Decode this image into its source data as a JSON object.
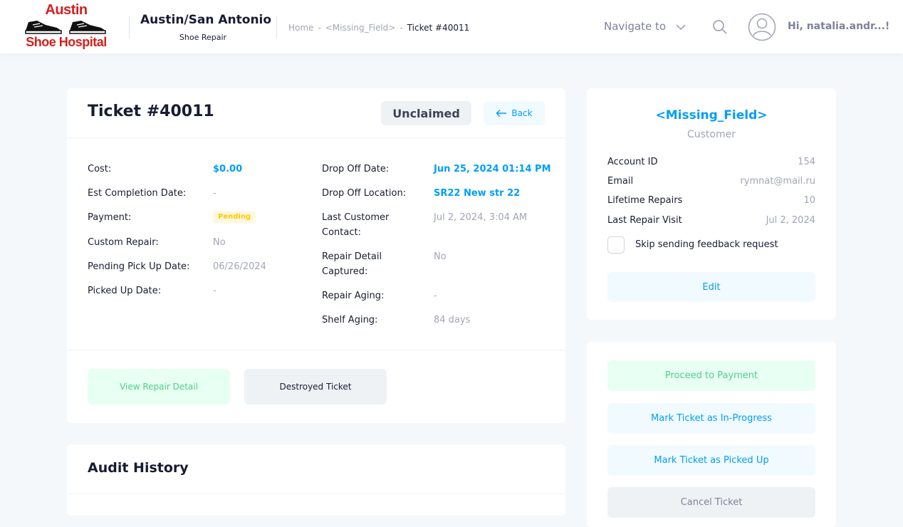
{
  "header": {
    "logo_line1": "Austin",
    "logo_line2": "Shoe Hospital",
    "brand_title": "Austin/San Antonio",
    "brand_subtitle": "Shoe Repair",
    "breadcrumb": [
      "Home",
      "<Missing_Field>",
      "Ticket #40011"
    ],
    "breadcrumb_sep": "-",
    "navigate_label": "Navigate to",
    "greeting": "Hi, natalia.andr...!",
    "icons": [
      "chevron-down-icon",
      "search-icon",
      "user-avatar-icon"
    ]
  },
  "ticket": {
    "title": "Ticket #40011",
    "status": "Unclaimed",
    "back_label": "Back",
    "left_fields": [
      {
        "label": "Cost:",
        "value": "$0.00"
      },
      {
        "label": "Est Completion Date:",
        "value": "-"
      },
      {
        "label": "Payment:",
        "value": "Pending"
      },
      {
        "label": "Custom Repair:",
        "value": "No"
      },
      {
        "label": "Pending Pick Up Date:",
        "value": "06/26/2024"
      },
      {
        "label": "Picked Up Date:",
        "value": "-"
      }
    ],
    "right_fields": [
      {
        "label": "Drop Off Date:",
        "value": "Jun 25, 2024 01:14 PM"
      },
      {
        "label": "Drop Off Location:",
        "value": "SR22 New str 22"
      },
      {
        "label": "Last Customer Contact:",
        "value": "Jul 2, 2024, 3:04 AM"
      },
      {
        "label": "Repair Detail Captured:",
        "value": "No"
      },
      {
        "label": "Repair Aging:",
        "value": "-"
      },
      {
        "label": "Shelf Aging:",
        "value": "84 days"
      }
    ],
    "view_repair_label": "View Repair Detail",
    "destroyed_label": "Destroyed Ticket"
  },
  "audit": {
    "title": "Audit History"
  },
  "customer": {
    "name": "<Missing_Field>",
    "role": "Customer",
    "rows": [
      {
        "label": "Account ID",
        "value": "154"
      },
      {
        "label": "Email",
        "value": "rymnat@mail.ru"
      },
      {
        "label": "Lifetime Repairs",
        "value": "10"
      },
      {
        "label": "Last Repair Visit",
        "value": "Jul 2, 2024"
      }
    ],
    "skip_feedback_label": "Skip sending feedback request",
    "edit_label": "Edit"
  },
  "actions": {
    "proceed_payment": "Proceed to Payment",
    "mark_in_progress": "Mark Ticket as In-Progress",
    "mark_picked_up": "Mark Ticket as Picked Up",
    "cancel_ticket": "Cancel Ticket"
  },
  "colors": {
    "accent": "#009ef7",
    "success": "#50cd89",
    "warning": "#ffc700",
    "logo_red": "#d81e1e"
  }
}
